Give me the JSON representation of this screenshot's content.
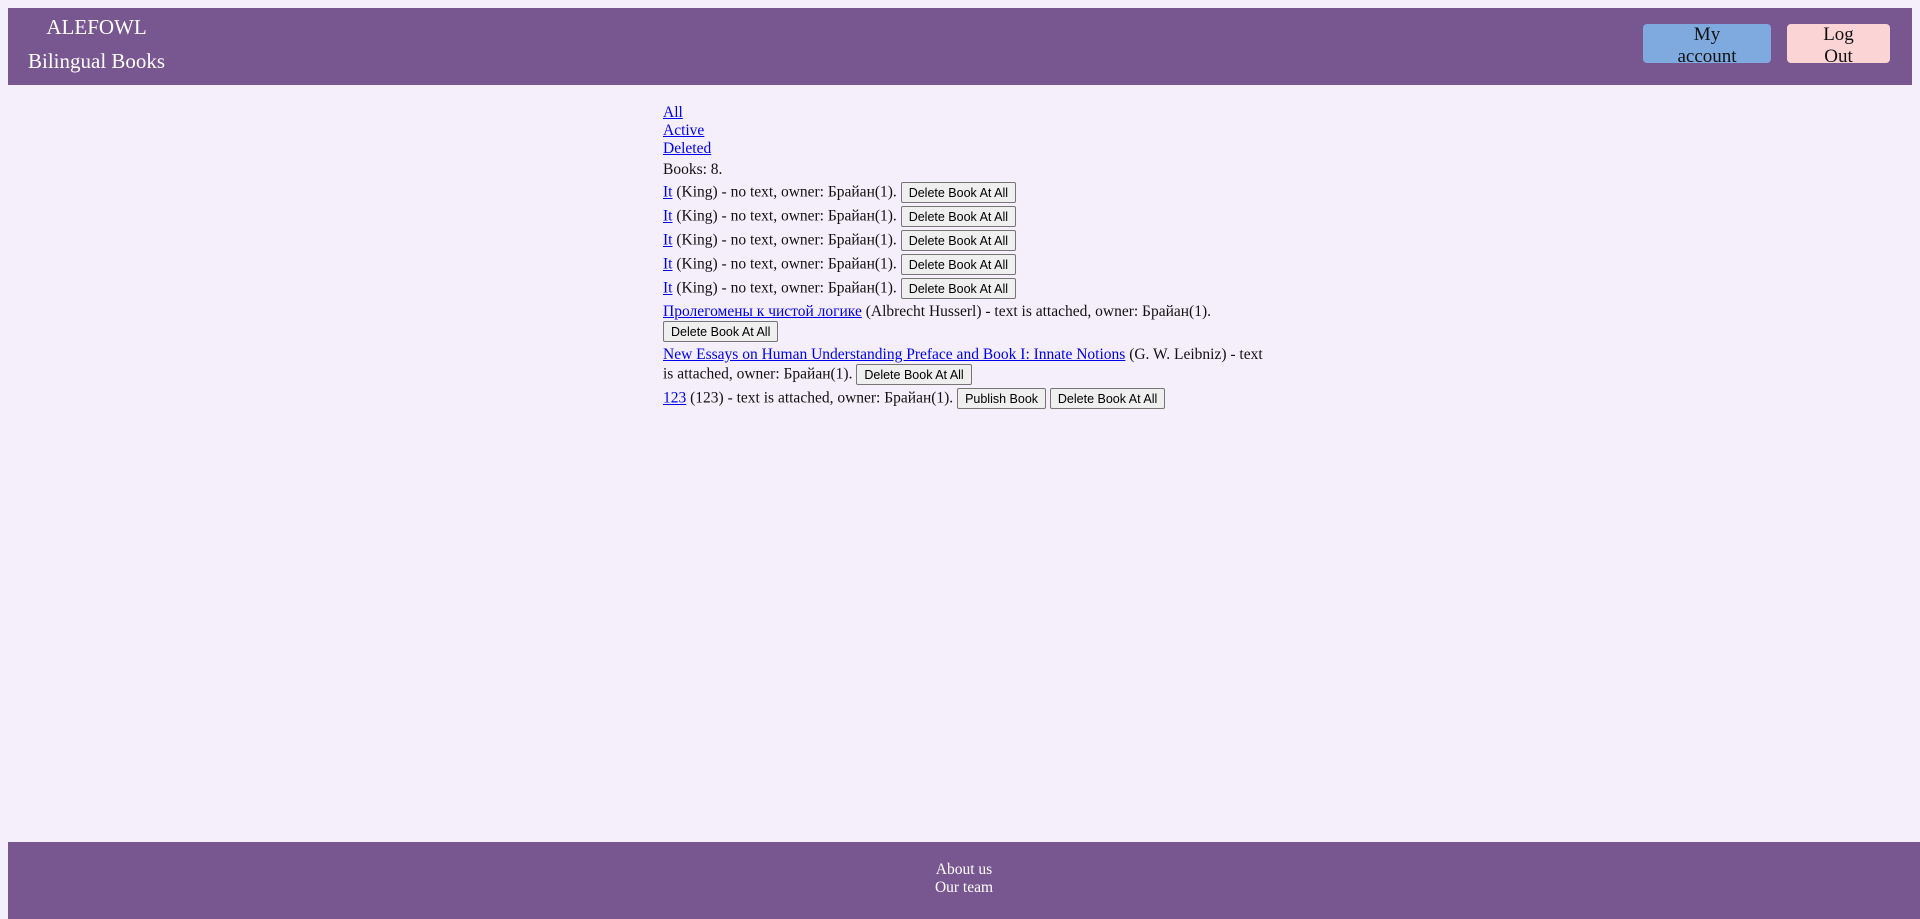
{
  "header": {
    "brand_name": "ALEFOWL",
    "brand_sub": "Bilingual Books",
    "my_account": "My account",
    "log_out": "Log Out"
  },
  "filters": {
    "all": "All",
    "active": "Active",
    "deleted": "Deleted"
  },
  "books_count": "Books: 8.",
  "books": [
    {
      "title": "It",
      "rest": " (King) - no text, owner: Брайан(1). ",
      "publish": "",
      "delete": "Delete Book At All"
    },
    {
      "title": "It",
      "rest": " (King) - no text, owner: Брайан(1). ",
      "publish": "",
      "delete": "Delete Book At All"
    },
    {
      "title": "It",
      "rest": " (King) - no text, owner: Брайан(1). ",
      "publish": "",
      "delete": "Delete Book At All"
    },
    {
      "title": "It",
      "rest": " (King) - no text, owner: Брайан(1). ",
      "publish": "",
      "delete": "Delete Book At All"
    },
    {
      "title": "It",
      "rest": " (King) - no text, owner: Брайан(1). ",
      "publish": "",
      "delete": "Delete Book At All"
    },
    {
      "title": "Пролегомены к чистой логике",
      "rest": " (Albrecht Husserl) - text is attached, owner: Брайан(1). ",
      "publish": "",
      "delete": "Delete Book At All"
    },
    {
      "title": "New Essays on Human Understanding Preface and Book I: Innate Notions",
      "rest": " (G. W. Leibniz) - text is attached, owner: Брайан(1). ",
      "publish": "",
      "delete": "Delete Book At All"
    },
    {
      "title": "123",
      "rest": " (123) - text is attached, owner: Брайан(1). ",
      "publish": "Publish Book",
      "delete": "Delete Book At All"
    }
  ],
  "footer": {
    "about": "About us",
    "team": "Our team"
  },
  "colors": {
    "header_bg": "#785690",
    "page_bg": "#f5effb",
    "account_btn": "#7faae0",
    "logout_btn": "#fbd4d6",
    "link": "#0000ee"
  }
}
